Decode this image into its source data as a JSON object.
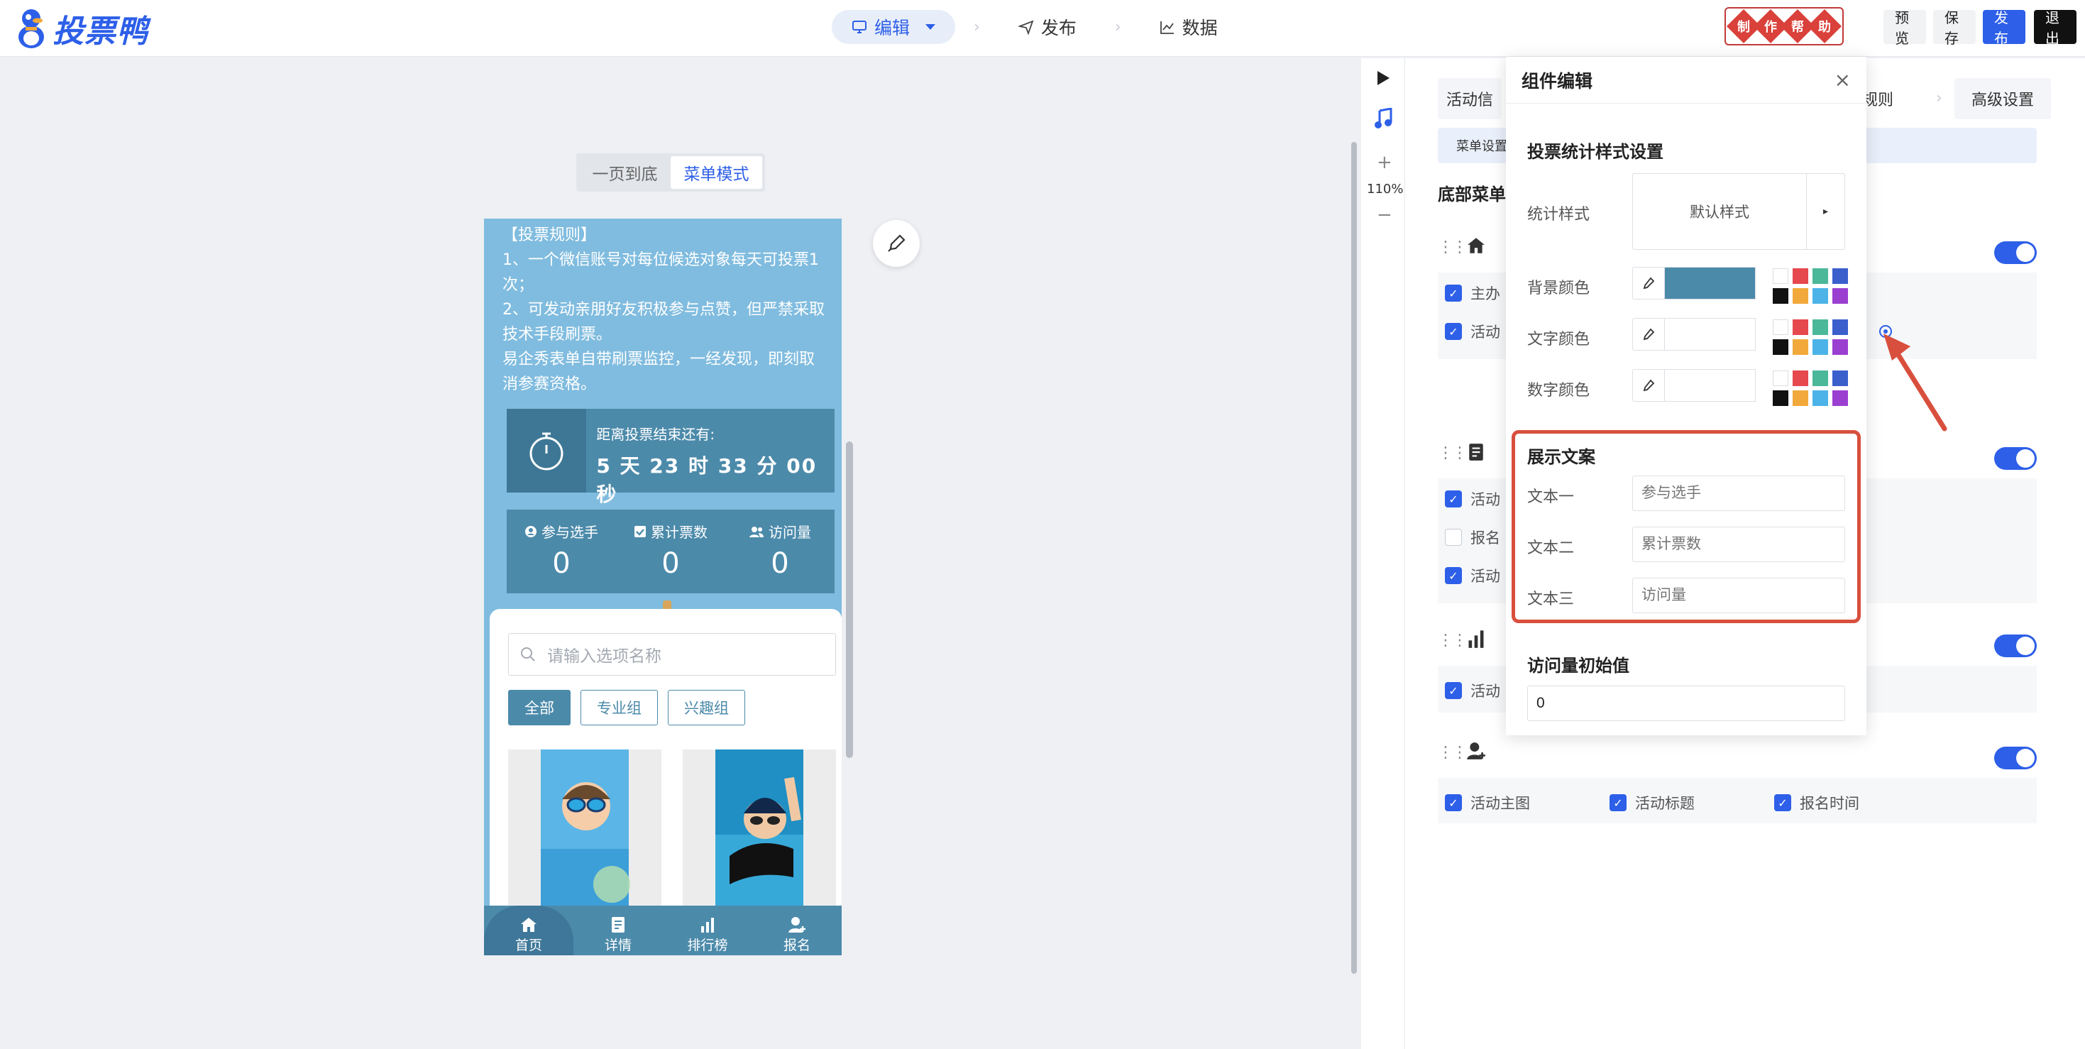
{
  "header": {
    "logo_text": "投票鸭",
    "steps": [
      {
        "label": "编辑",
        "icon": "monitor-icon"
      },
      {
        "label": "发布",
        "icon": "send-icon"
      },
      {
        "label": "数据",
        "icon": "line-chart-icon"
      }
    ],
    "help_chars": [
      "制",
      "作",
      "帮",
      "助"
    ],
    "buttons": {
      "preview": "预览",
      "save": "保存",
      "publish": "发布",
      "exit": "退出"
    },
    "colors": {
      "brand": "#2d5fe8",
      "publish_bg": "#2d5fe8",
      "exit_bg": "#111111"
    }
  },
  "canvas": {
    "modes": [
      "一页到底",
      "菜单模式"
    ],
    "active_mode": "菜单模式",
    "zoom": "110%",
    "rules": {
      "title": "【投票规则】",
      "line1": "1、一个微信账号对每位候选对象每天可投票1次；",
      "line2": "2、可发动亲朋好友积极参与点赞，但严禁采取技术手段刷票。",
      "line3": "易企秀表单自带刷票监控，一经发现，即刻取消参赛资格。"
    },
    "timer": {
      "label": "距离投票结束还有:",
      "value": "5 天  23 时  33 分  00 秒"
    },
    "stats": [
      {
        "label": "参与选手",
        "value": "0"
      },
      {
        "label": "累计票数",
        "value": "0"
      },
      {
        "label": "访问量",
        "value": "0"
      }
    ],
    "search_placeholder": "请输入选项名称",
    "groups": [
      "全部",
      "专业组",
      "兴趣组"
    ],
    "tabbar": [
      {
        "label": "首页",
        "icon": "home-icon"
      },
      {
        "label": "详情",
        "icon": "document-icon"
      },
      {
        "label": "排行榜",
        "icon": "bar-chart-icon"
      },
      {
        "label": "报名",
        "icon": "user-add-icon"
      }
    ],
    "theme_color": "#80bcdf"
  },
  "panel": {
    "tabs": {
      "first": "活动信",
      "rules": "票规则",
      "advanced": "高级设置"
    },
    "subnav": "菜单设置",
    "bottom_menu_title": "底部菜单",
    "rows": [
      {
        "checks": [
          {
            "label": "主办",
            "checked": true
          },
          {
            "label": "活动",
            "checked": true
          }
        ]
      },
      {
        "checks": [
          {
            "label": "活动",
            "checked": true
          },
          {
            "label": "报名",
            "checked": false
          },
          {
            "label": "活动",
            "checked": true
          }
        ]
      },
      {
        "checks": [
          {
            "label": "活动",
            "checked": true
          }
        ]
      },
      {
        "checks": [
          {
            "label": "活动主图",
            "checked": true
          },
          {
            "label": "活动标题",
            "checked": true
          },
          {
            "label": "报名时间",
            "checked": true
          }
        ]
      }
    ]
  },
  "dialog": {
    "title": "组件编辑",
    "close": "×",
    "section1": "投票统计样式设置",
    "style_label": "统计样式",
    "style_value": "默认样式",
    "bg_color_label": "背景颜色",
    "text_color_label": "文字颜色",
    "num_color_label": "数字颜色",
    "bg_color": "#4c8aaa",
    "palette": [
      "#ffffff",
      "#e5484d",
      "#4bb89a",
      "#3a5fcd",
      "#111111",
      "#f2a93b",
      "#4cb3e8",
      "#9b3fd1"
    ],
    "section2": "展示文案",
    "text1_label": "文本一",
    "text1_placeholder": "参与选手",
    "text2_label": "文本二",
    "text2_placeholder": "累计票数",
    "text3_label": "文本三",
    "text3_placeholder": "访问量",
    "section3": "访问量初始值",
    "initial_value": "0",
    "highlight_color": "#d94f3d"
  }
}
